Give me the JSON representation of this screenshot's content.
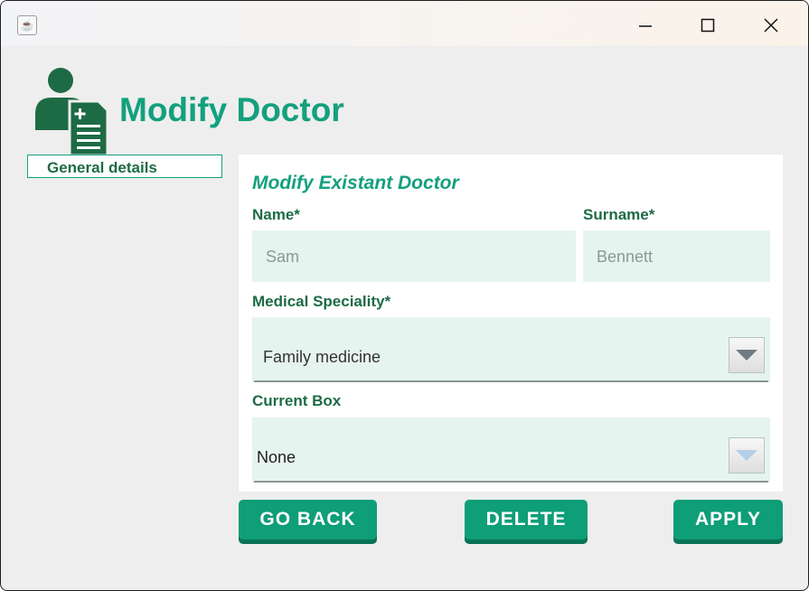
{
  "window": {
    "icon": "java-icon",
    "controls": [
      "minimize-icon",
      "maximize-icon",
      "close-icon"
    ]
  },
  "header": {
    "icon": "doctor-icon",
    "title": "Modify Doctor"
  },
  "sidebar": {
    "items": [
      {
        "label": "General details"
      }
    ]
  },
  "form": {
    "title": "Modify Existant Doctor",
    "name": {
      "label": "Name*",
      "placeholder": "Sam"
    },
    "surname": {
      "label": "Surname*",
      "placeholder": "Bennett"
    },
    "speciality": {
      "label": "Medical Speciality*",
      "value": "Family medicine"
    },
    "box": {
      "label": "Current Box",
      "value": "None"
    }
  },
  "buttons": {
    "go_back": "GO BACK",
    "delete": "DELETE",
    "apply": "APPLY"
  },
  "colors": {
    "accent": "#13a07e",
    "label": "#1d6b45",
    "field_bg": "#e6f4ef",
    "button": "#0e9e78"
  }
}
